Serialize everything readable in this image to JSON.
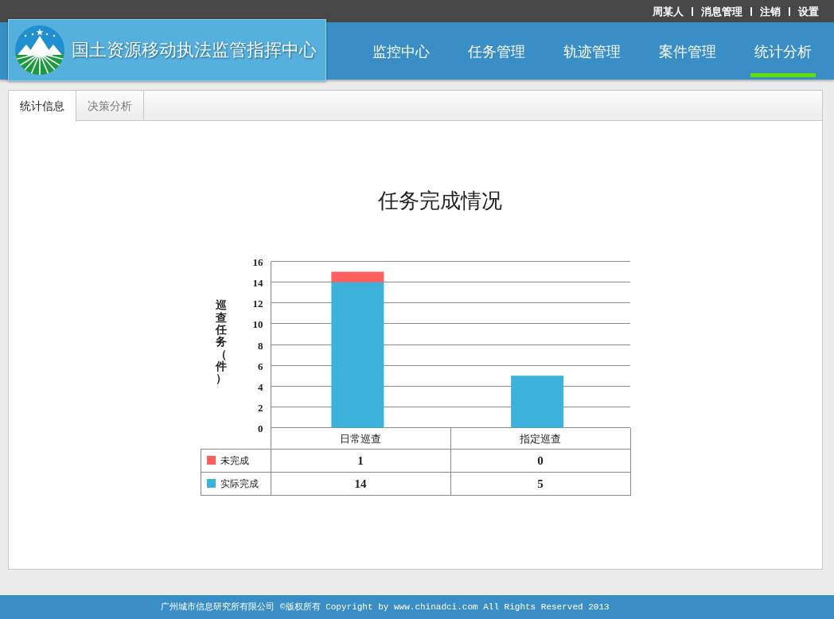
{
  "top_bar": {
    "links": [
      "周某人",
      "消息管理",
      "注销",
      "设置"
    ]
  },
  "header": {
    "title": "国土资源移动执法监管指挥中心",
    "nav": [
      {
        "label": "监控中心",
        "selected": false
      },
      {
        "label": "任务管理",
        "selected": false
      },
      {
        "label": "轨迹管理",
        "selected": false
      },
      {
        "label": "案件管理",
        "selected": false
      },
      {
        "label": "统计分析",
        "selected": true
      }
    ]
  },
  "panel": {
    "tabs": [
      {
        "label": "统计信息",
        "selected": true
      },
      {
        "label": "决策分析",
        "selected": false
      }
    ],
    "chart_data": [
      {
        "type": "bar",
        "title": "任务完成情况",
        "ylabel": "巡查任务（件）",
        "categories": [
          "日常巡查",
          "指定巡查"
        ],
        "stacked": true,
        "series": [
          {
            "name": "未完成",
            "color": "#fd5e5e",
            "values": [
              1,
              0
            ],
            "value_labels": [
              "1",
              "0"
            ]
          },
          {
            "name": "实际完成",
            "color": "#3cb1da",
            "values": [
              14,
              5
            ],
            "value_labels": [
              "14",
              "5"
            ]
          }
        ],
        "ylim": [
          0,
          16
        ],
        "yticks": [
          0,
          2,
          4,
          6,
          8,
          10,
          12,
          14,
          16
        ],
        "grid": true,
        "legend": "bottom"
      }
    ]
  },
  "footer": {
    "text": "广州城市信息研究所有限公司 ©版权所有 Copyright by www.chinadci.com All Rights Reserved 2013"
  }
}
